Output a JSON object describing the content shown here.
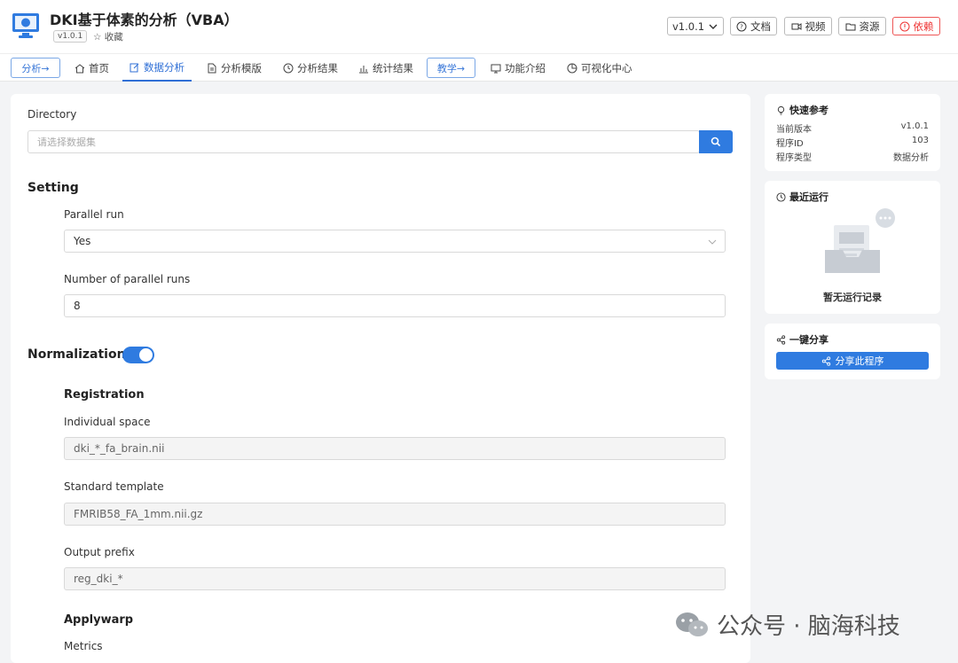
{
  "app": {
    "title": "DKI基于体素的分析（VBA）",
    "version_badge": "v1.0.1",
    "favorite_label": "☆ 收藏"
  },
  "header_buttons": {
    "version": "v1.0.1",
    "docs": "文档",
    "video": "视频",
    "resources": "资源",
    "dependencies": "依赖"
  },
  "nav": {
    "analysis_btn": "分析→",
    "teaching_btn": "教学→",
    "items": [
      {
        "label": "首页",
        "icon": "home-icon"
      },
      {
        "label": "数据分析",
        "icon": "edit-icon",
        "active": true
      },
      {
        "label": "分析模版",
        "icon": "file-icon"
      },
      {
        "label": "分析结果",
        "icon": "clock-icon"
      },
      {
        "label": "统计结果",
        "icon": "bar-chart-icon"
      },
      {
        "label": "功能介绍",
        "icon": "monitor-icon"
      },
      {
        "label": "可视化中心",
        "icon": "pie-icon"
      }
    ]
  },
  "form": {
    "directory_label": "Directory",
    "directory_placeholder": "请选择数据集",
    "setting_title": "Setting",
    "parallel_run_label": "Parallel run",
    "parallel_run_value": "Yes",
    "num_parallel_label": "Number of parallel runs",
    "num_parallel_value": "8",
    "normalization_title": "Normalization",
    "normalization_enabled": true,
    "registration_title": "Registration",
    "individual_space_label": "Individual space",
    "individual_space_value": "dki_*_fa_brain.nii",
    "standard_template_label": "Standard template",
    "standard_template_value": "FMRIB58_FA_1mm.nii.gz",
    "output_prefix_label": "Output prefix",
    "output_prefix_value": "reg_dki_*",
    "applywarp_title": "Applywarp",
    "metrics_label": "Metrics"
  },
  "quick_ref": {
    "title": "快速参考",
    "rows": [
      {
        "key": "当前版本",
        "value": "v1.0.1"
      },
      {
        "key": "程序ID",
        "value": "103"
      },
      {
        "key": "程序类型",
        "value": "数据分析"
      }
    ]
  },
  "recent": {
    "title": "最近运行",
    "empty_text": "暂无运行记录"
  },
  "share": {
    "title": "一键分享",
    "button": "分享此程序"
  },
  "watermark": "公众号 · 脑海科技",
  "colors": {
    "accent": "#2f7be0",
    "danger": "#e33"
  }
}
